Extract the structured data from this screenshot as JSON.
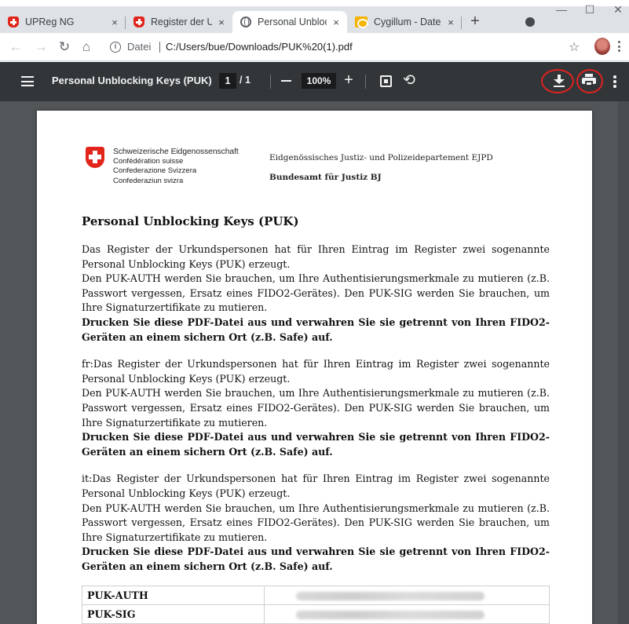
{
  "browser": {
    "tabs": [
      {
        "title": "UPReg NG",
        "favicon": "swiss-shield-icon",
        "active": false
      },
      {
        "title": "Register der Urku",
        "favicon": "swiss-shield-icon",
        "active": false
      },
      {
        "title": "Personal Unblocki",
        "favicon": "globe-icon",
        "active": true
      },
      {
        "title": "Cygillum - Dateie",
        "favicon": "folder-icon",
        "active": false
      }
    ],
    "tab_close_glyph": "×",
    "new_tab_glyph": "+",
    "window_controls": {
      "minimize": "—",
      "maximize": "☐",
      "close": "✕"
    },
    "address": {
      "scheme_label": "Datei",
      "url": "C:/Users/bue/Downloads/PUK%20(1).pdf"
    }
  },
  "pdf_toolbar": {
    "title": "Personal Unblocking Keys (PUK)",
    "current_page": "1",
    "total_pages": "/ 1",
    "zoom": "100%",
    "highlight_color": "#e0211f"
  },
  "document": {
    "header": {
      "federation_names": [
        "Schweizerische Eidgenossenschaft",
        "Confédération suisse",
        "Confederazione Svizzera",
        "Confederaziun svizra"
      ],
      "department": "Eidgenössisches Justiz- und Polizeidepartement EJPD",
      "office": "Bundesamt für Justiz BJ"
    },
    "title": "Personal Unblocking Keys (PUK)",
    "paragraphs": [
      {
        "text": "Das Register der Urkundspersonen hat für Ihren Eintrag im Register zwei sogenannte Personal Unblocking Keys (PUK) erzeugt.",
        "text2": "Den PUK-AUTH werden Sie brauchen, um Ihre Authentisierungsmerkmale zu mutieren (z.B. Passwort vergessen, Ersatz eines FIDO2-Gerätes). Den PUK-SIG werden Sie brauchen, um Ihre Signaturzertifikate zu mutieren.",
        "bold": "Drucken Sie diese PDF-Datei aus und verwahren Sie sie getrennt von Ihren FIDO2-Geräten an einem sichern Ort (z.B. Safe) auf."
      },
      {
        "text": "fr:Das Register der Urkundspersonen hat für Ihren Eintrag im Register zwei sogenannte Personal Unblocking Keys (PUK) erzeugt.",
        "text2": "Den PUK-AUTH werden Sie brauchen, um Ihre Authentisierungsmerkmale zu mutieren (z.B. Passwort vergessen, Ersatz eines FIDO2-Gerätes). Den PUK-SIG werden Sie brauchen, um Ihre Signaturzertifikate zu mutieren.",
        "bold": "Drucken Sie diese PDF-Datei aus und verwahren Sie sie getrennt von Ihren FIDO2-Geräten an einem sichern Ort (z.B. Safe) auf."
      },
      {
        "text": "it:Das Register der Urkundspersonen hat für Ihren Eintrag im Register zwei sogenannte Personal Unblocking Keys (PUK) erzeugt.",
        "text2": "Den PUK-AUTH werden Sie brauchen, um Ihre Authentisierungsmerkmale zu mutieren (z.B. Passwort vergessen, Ersatz eines FIDO2-Gerätes). Den PUK-SIG werden Sie brauchen, um Ihre Signaturzertifikate zu mutieren.",
        "bold": "Drucken Sie diese PDF-Datei aus und verwahren Sie sie getrennt von Ihren FIDO2-Geräten an einem sichern Ort (z.B. Safe) auf."
      }
    ],
    "puk_table": [
      {
        "label": "PUK-AUTH"
      },
      {
        "label": "PUK-SIG"
      }
    ]
  }
}
